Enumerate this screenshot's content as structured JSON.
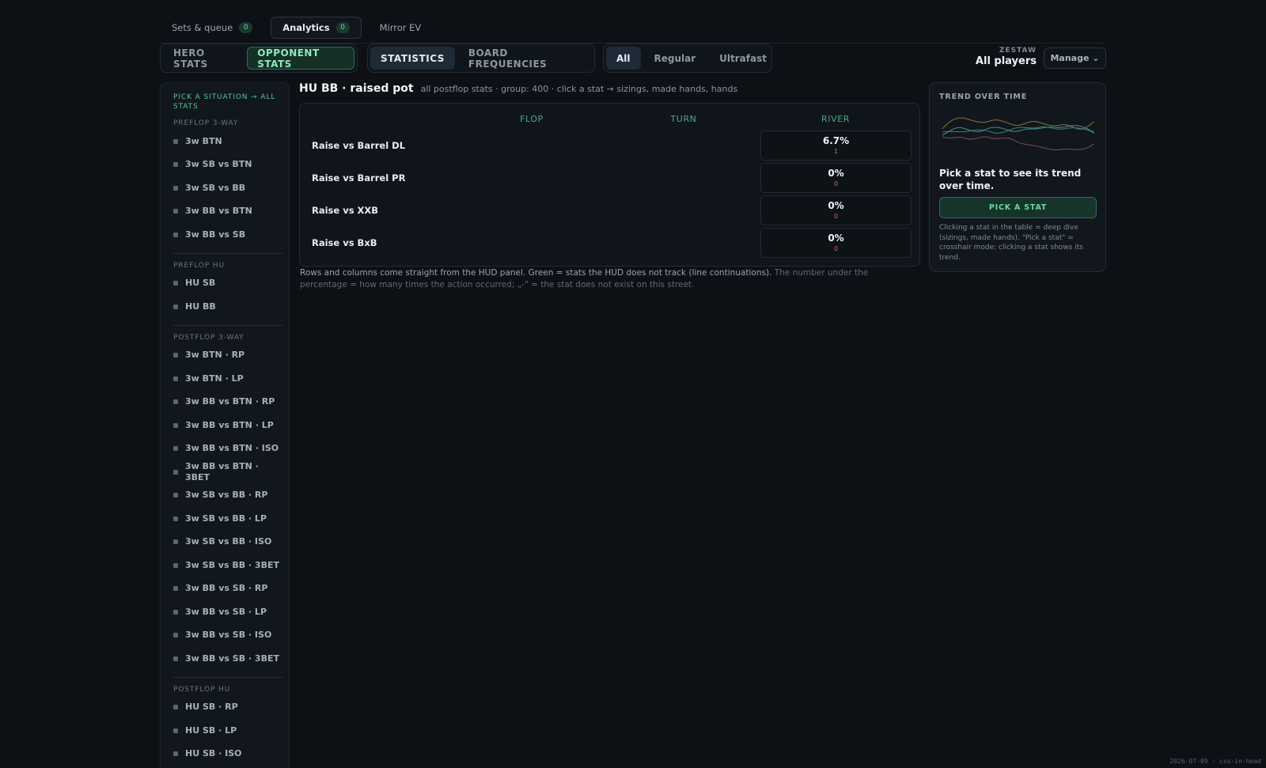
{
  "top_tabs": [
    {
      "label": "Sets & queue",
      "badge": "0"
    },
    {
      "label": "Analytics",
      "badge": "0"
    },
    {
      "label": "Mirror EV"
    }
  ],
  "hero_opponent": {
    "hero": "HERO STATS",
    "opponent": "OPPONENT STATS"
  },
  "view_tabs": {
    "statistics": "STATISTICS",
    "board": "BOARD FREQUENCIES"
  },
  "speed_tabs": {
    "all": "All",
    "regular": "Regular",
    "ultrafast": "Ultrafast"
  },
  "player": {
    "label": "ZESTAW",
    "name": "All players",
    "manage": "Manage ⌄"
  },
  "sidebar": {
    "hint": "PICK A SITUATION → ALL STATS",
    "groups": [
      {
        "title": "PREFLOP 3-WAY",
        "items": [
          "3w BTN",
          "3w SB vs BTN",
          "3w SB vs BB",
          "3w BB vs BTN",
          "3w BB vs SB"
        ]
      },
      {
        "title": "PREFLOP HU",
        "items": [
          "HU SB",
          "HU BB"
        ]
      },
      {
        "title": "POSTFLOP 3-WAY",
        "items": [
          "3w BTN · RP",
          "3w BTN · LP",
          "3w BB vs BTN · RP",
          "3w BB vs BTN · LP",
          "3w BB vs BTN · ISO",
          "3w BB vs BTN · 3BET",
          "3w SB vs BB · RP",
          "3w SB vs BB · LP",
          "3w SB vs BB · ISO",
          "3w SB vs BB · 3BET",
          "3w BB vs SB · RP",
          "3w BB vs SB · LP",
          "3w BB vs SB · ISO",
          "3w BB vs SB · 3BET"
        ]
      },
      {
        "title": "POSTFLOP HU",
        "items": [
          "HU SB · RP",
          "HU SB · LP",
          "HU SB · ISO"
        ]
      }
    ]
  },
  "main": {
    "title": "HU BB · raised pot",
    "subtitle": "all postflop stats · group: 400 · click a stat → sizings, made hands, hands",
    "columns": [
      "FLOP",
      "TURN",
      "RIVER"
    ],
    "rows": [
      {
        "label": "Raise vs Barrel DL",
        "flop": "·",
        "turn": "·",
        "river": "6.7%",
        "river_count": "1"
      },
      {
        "label": "Raise vs Barrel PR",
        "flop": "·",
        "turn": "·",
        "river": "0%",
        "river_count": "0"
      },
      {
        "label": "Raise vs XXB",
        "flop": "·",
        "turn": "·",
        "river": "0%",
        "river_count": "0"
      },
      {
        "label": "Raise vs BxB",
        "flop": "·",
        "turn": "·",
        "river": "0%",
        "river_count": "0"
      }
    ],
    "note": "Rows and columns come straight from the HUD panel. Green = stats the HUD does not track (line continuations).",
    "note_dim": "The number under the percentage = how many times the action occurred; „-\" = the stat does not exist on this street."
  },
  "trend": {
    "label": "TREND OVER TIME",
    "heading": "Pick a stat to see its trend over time.",
    "button": "PICK A STAT",
    "note": "Clicking a stat in the table = deep dive (sizings, made hands). \"Pick a stat\" = crosshair mode: clicking a stat shows its trend.",
    "line_colors": [
      "#8a6f3a",
      "#3f8f9a",
      "#7a4a68",
      "#3b7f7f"
    ]
  },
  "footer": "2026-07-09 · css-in-head"
}
